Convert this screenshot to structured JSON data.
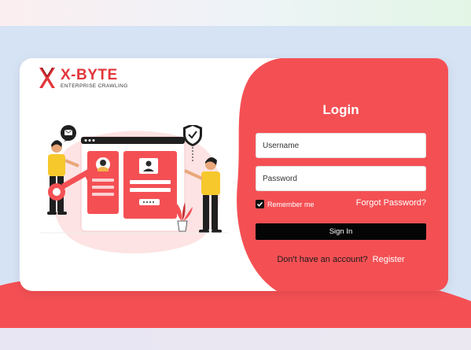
{
  "brand": {
    "name": "X-BYTE",
    "tagline": "ENTERPRISE CRAWLING",
    "color": "#e3363b"
  },
  "login": {
    "title": "Login",
    "username_placeholder": "Username",
    "password_placeholder": "Password",
    "remember_label": "Remember me",
    "remember_checked": true,
    "forgot_label": "Forgot Password?",
    "signin_label": "Sign In",
    "no_account_text": "Don't have an account?",
    "register_label": "Register"
  },
  "theme": {
    "panel_red": "#f45054",
    "background_blue": "#d6e3f4",
    "button_black": "#050505"
  },
  "icons": [
    "logo-x-icon",
    "mail-icon",
    "shield-check-icon",
    "user-avatar-icon",
    "key-icon",
    "plant-icon",
    "checkmark-icon"
  ]
}
